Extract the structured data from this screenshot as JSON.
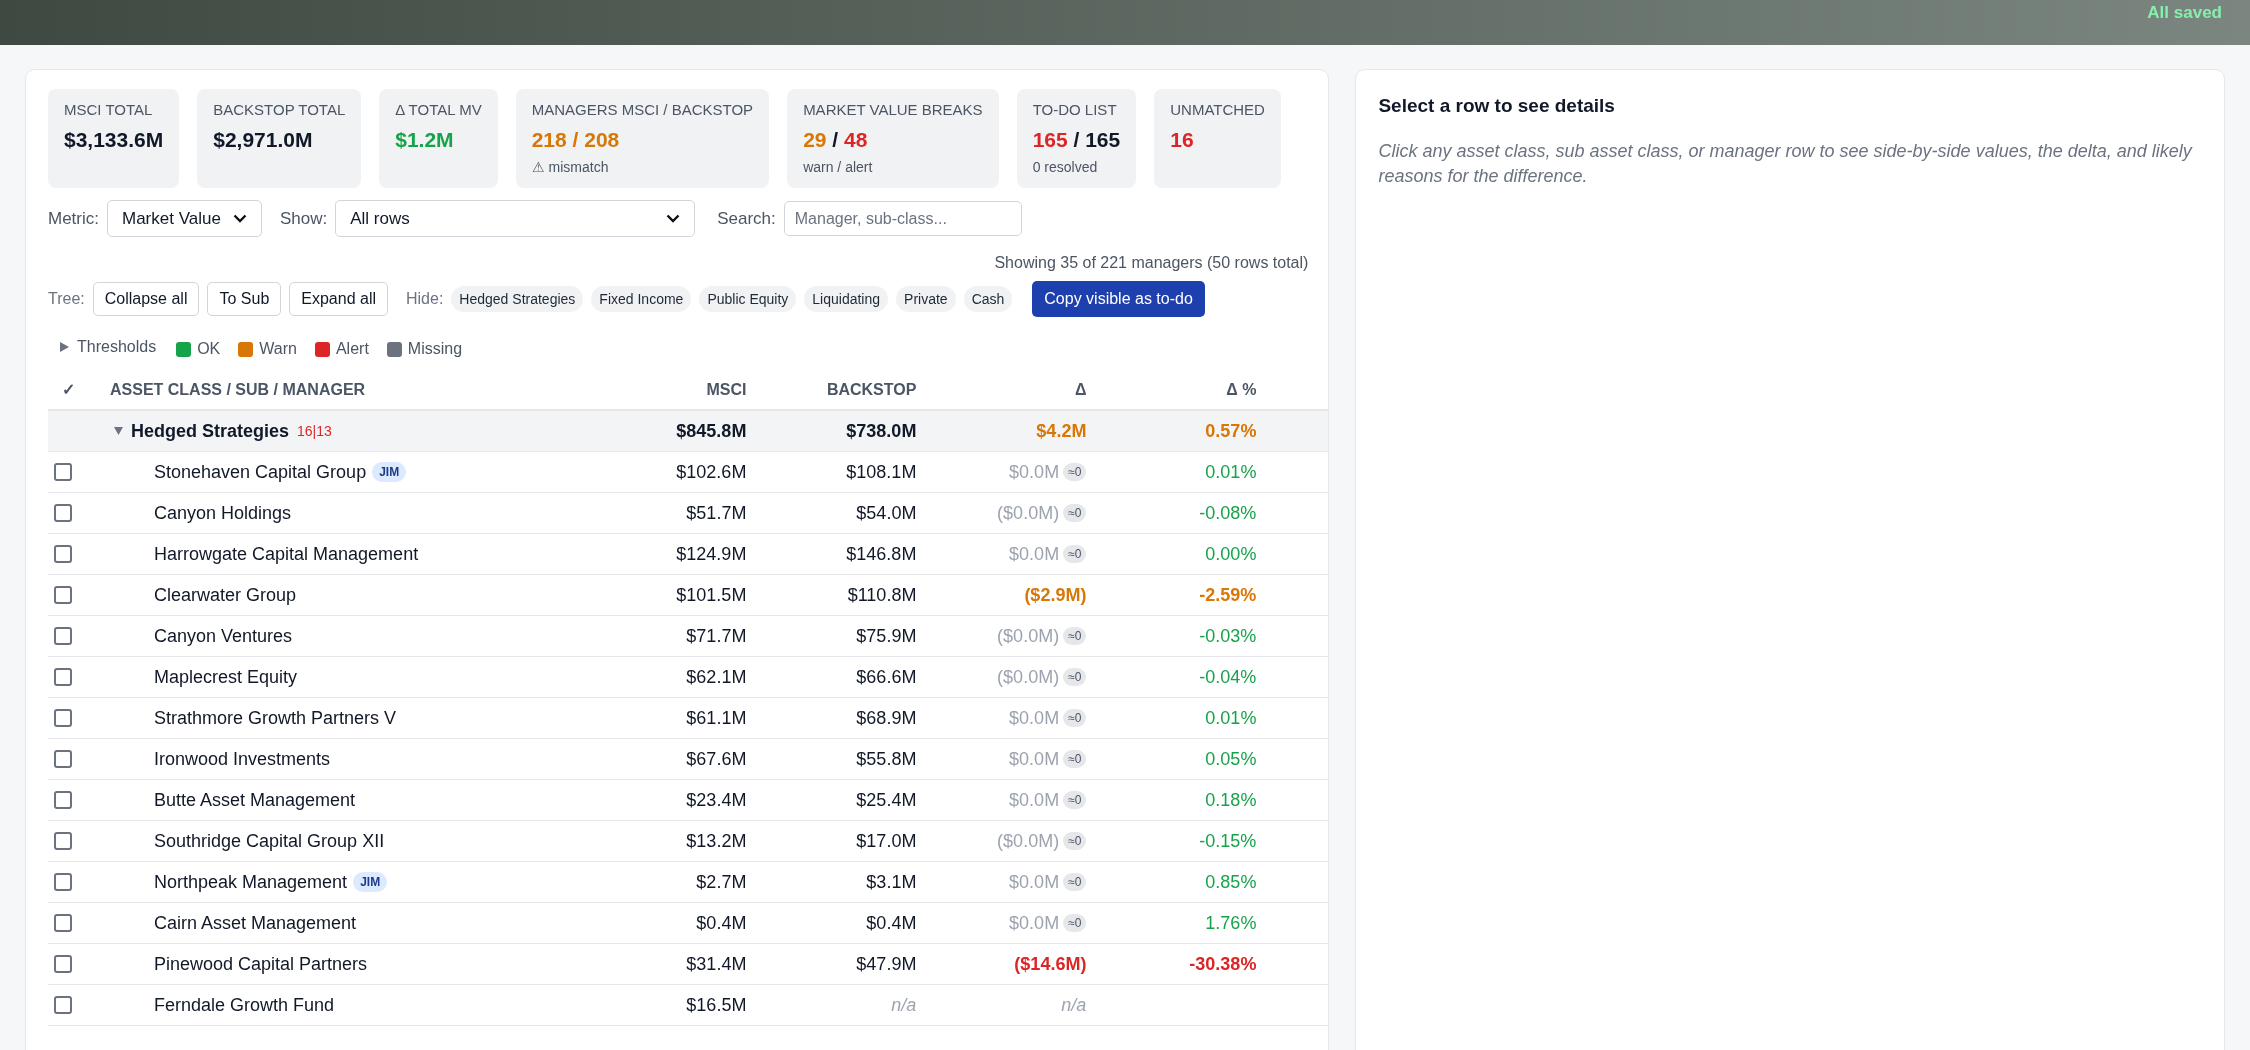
{
  "header": {
    "save_status": "All saved"
  },
  "kpis": [
    {
      "label": "MSCI TOTAL",
      "value": [
        {
          "text": "$3,133.6M",
          "color": "#111827"
        }
      ]
    },
    {
      "label": "BACKSTOP TOTAL",
      "value": [
        {
          "text": "$2,971.0M",
          "color": "#111827"
        }
      ]
    },
    {
      "label": "Δ TOTAL MV",
      "value": [
        {
          "text": "$1.2M",
          "color": "#16a34a"
        }
      ]
    },
    {
      "label": "MANAGERS MSCI / BACKSTOP",
      "value": [
        {
          "text": "218 / 208",
          "color": "#d97706"
        }
      ],
      "note": "⚠ mismatch"
    },
    {
      "label": "MARKET VALUE BREAKS",
      "value": [
        {
          "text": "29",
          "color": "#d97706"
        },
        {
          "text": " / ",
          "color": "#111827"
        },
        {
          "text": "48",
          "color": "#dc2626"
        }
      ],
      "note": "warn / alert"
    },
    {
      "label": "TO-DO LIST",
      "value": [
        {
          "text": "165",
          "color": "#dc2626"
        },
        {
          "text": " / 165",
          "color": "#111827"
        }
      ],
      "note": "0 resolved"
    },
    {
      "label": "UNMATCHED",
      "value": [
        {
          "text": "16",
          "color": "#dc2626"
        }
      ]
    }
  ],
  "filters": {
    "metric_label": "Metric:",
    "metric_value": "Market Value",
    "show_label": "Show:",
    "show_value": "All rows",
    "search_label": "Search:",
    "search_placeholder": "Manager, sub-class..."
  },
  "showing": "Showing 35 of 221 managers (50 rows total)",
  "tree": {
    "label": "Tree:",
    "buttons": [
      "Collapse all",
      "To Sub",
      "Expand all"
    ]
  },
  "hide": {
    "label": "Hide:",
    "chips": [
      "Hedged Strategies",
      "Fixed Income",
      "Public Equity",
      "Liquidating",
      "Private",
      "Cash"
    ]
  },
  "copy_button": "Copy visible as to-do",
  "thresholds": {
    "label": "Thresholds",
    "expanded": false
  },
  "legend": [
    {
      "label": "OK",
      "color": "#16a34a"
    },
    {
      "label": "Warn",
      "color": "#d97706"
    },
    {
      "label": "Alert",
      "color": "#dc2626"
    },
    {
      "label": "Missing",
      "color": "#6b7280"
    }
  ],
  "table": {
    "columns": [
      "✓",
      "ASSET CLASS / SUB / MANAGER",
      "MSCI",
      "BACKSTOP",
      "Δ",
      "Δ %"
    ],
    "group": {
      "name": "Hedged Strategies",
      "counts": "16|13",
      "expanded": true,
      "msci": "$845.8M",
      "backstop": "$738.0M",
      "delta": "$4.2M",
      "pct": "0.57%",
      "kind": "warn"
    },
    "rows": [
      {
        "name": "Stonehaven Capital Group",
        "tag": "JIM",
        "checked": false,
        "msci": "$102.6M",
        "backstop": "$108.1M",
        "delta": "$0.0M",
        "badge": "≈0",
        "pct": "0.01%",
        "kind": "ok"
      },
      {
        "name": "Canyon Holdings",
        "checked": false,
        "msci": "$51.7M",
        "backstop": "$54.0M",
        "delta": "($0.0M)",
        "badge": "≈0",
        "pct": "-0.08%",
        "kind": "ok"
      },
      {
        "name": "Harrowgate Capital Management",
        "checked": false,
        "msci": "$124.9M",
        "backstop": "$146.8M",
        "delta": "$0.0M",
        "badge": "≈0",
        "pct": "0.00%",
        "kind": "ok"
      },
      {
        "name": "Clearwater Group",
        "checked": false,
        "msci": "$101.5M",
        "backstop": "$110.8M",
        "delta": "($2.9M)",
        "pct": "-2.59%",
        "kind": "warn"
      },
      {
        "name": "Canyon Ventures",
        "checked": false,
        "msci": "$71.7M",
        "backstop": "$75.9M",
        "delta": "($0.0M)",
        "badge": "≈0",
        "pct": "-0.03%",
        "kind": "ok"
      },
      {
        "name": "Maplecrest Equity",
        "checked": false,
        "msci": "$62.1M",
        "backstop": "$66.6M",
        "delta": "($0.0M)",
        "badge": "≈0",
        "pct": "-0.04%",
        "kind": "ok"
      },
      {
        "name": "Strathmore Growth Partners V",
        "checked": false,
        "msci": "$61.1M",
        "backstop": "$68.9M",
        "delta": "$0.0M",
        "badge": "≈0",
        "pct": "0.01%",
        "kind": "ok"
      },
      {
        "name": "Ironwood Investments",
        "checked": false,
        "msci": "$67.6M",
        "backstop": "$55.8M",
        "delta": "$0.0M",
        "badge": "≈0",
        "pct": "0.05%",
        "kind": "ok"
      },
      {
        "name": "Butte Asset Management",
        "checked": false,
        "msci": "$23.4M",
        "backstop": "$25.4M",
        "delta": "$0.0M",
        "badge": "≈0",
        "pct": "0.18%",
        "kind": "ok"
      },
      {
        "name": "Southridge Capital Group XII",
        "checked": false,
        "msci": "$13.2M",
        "backstop": "$17.0M",
        "delta": "($0.0M)",
        "badge": "≈0",
        "pct": "-0.15%",
        "kind": "ok"
      },
      {
        "name": "Northpeak Management",
        "tag": "JIM",
        "checked": false,
        "msci": "$2.7M",
        "backstop": "$3.1M",
        "delta": "$0.0M",
        "badge": "≈0",
        "pct": "0.85%",
        "kind": "ok"
      },
      {
        "name": "Cairn Asset Management",
        "checked": false,
        "msci": "$0.4M",
        "backstop": "$0.4M",
        "delta": "$0.0M",
        "badge": "≈0",
        "pct": "1.76%",
        "kind": "ok"
      },
      {
        "name": "Pinewood Capital Partners",
        "checked": false,
        "msci": "$31.4M",
        "backstop": "$47.9M",
        "delta": "($14.6M)",
        "pct": "-30.38%",
        "kind": "alert"
      },
      {
        "name": "Ferndale Growth Fund",
        "checked": false,
        "msci": "$16.5M",
        "backstop": "n/a",
        "delta": "n/a",
        "kind": "missing"
      }
    ]
  },
  "details": {
    "title": "Select a row to see details",
    "hint": "Click any asset class, sub asset class, or manager row to see side-by-side values, the delta, and likely reasons for the difference."
  }
}
